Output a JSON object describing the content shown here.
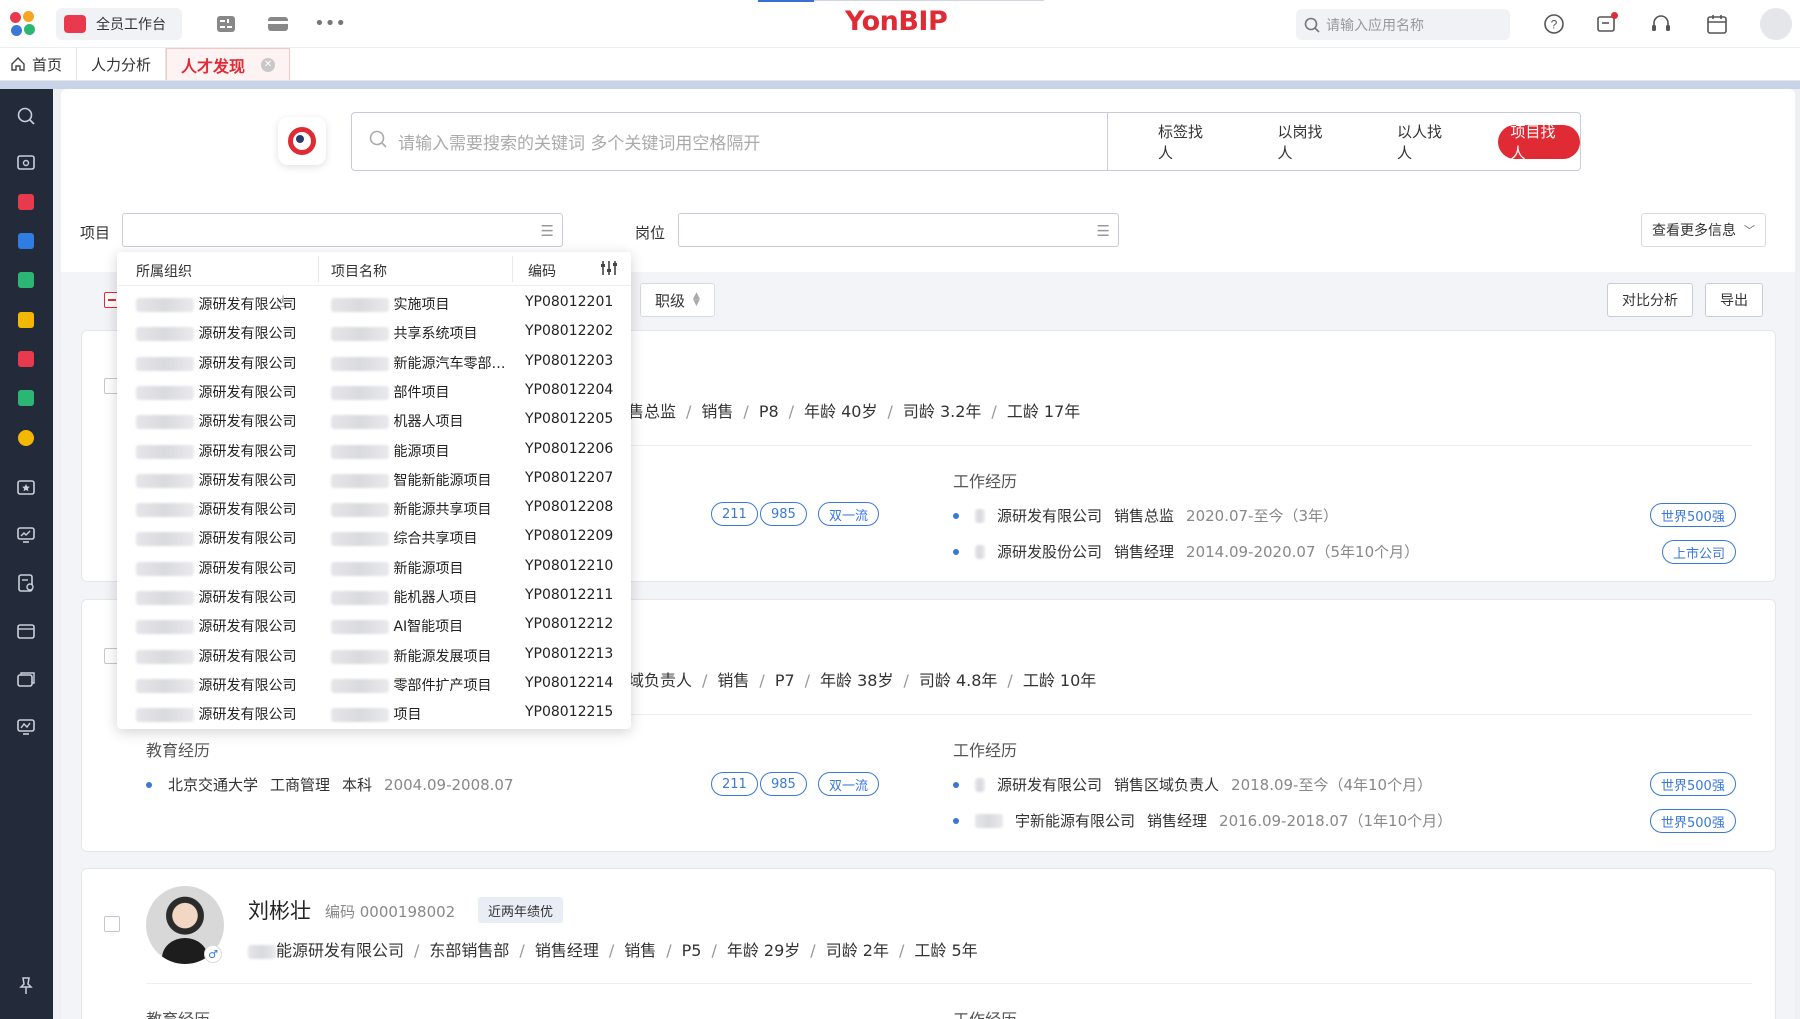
{
  "topbar": {
    "workbench_label": "全员工作台",
    "brand": "YonBIP",
    "app_search_placeholder": "请输入应用名称",
    "more_glyph": "•••"
  },
  "tabs": [
    {
      "label": "首页",
      "icon": "home-icon"
    },
    {
      "label": "人力分析"
    },
    {
      "label": "人才发现",
      "active": true
    }
  ],
  "search": {
    "placeholder": "请输入需要搜索的关键词 多个关键词用空格隔开",
    "modes": [
      "标签找人",
      "以岗找人",
      "以人找人",
      "项目找人"
    ],
    "active_mode": "项目找人"
  },
  "filters": {
    "project_label": "项目",
    "position_label": "岗位",
    "more_info": "查看更多信息"
  },
  "toolbar": {
    "sort_label": "职级",
    "compare": "对比分析",
    "export": "导出"
  },
  "dropdown": {
    "headers": {
      "org": "所属组织",
      "project": "项目名称",
      "code": "编码"
    },
    "rows": [
      {
        "org": "源研发有限公司",
        "project": "实施项目",
        "code": "YP08012201"
      },
      {
        "org": "源研发有限公司",
        "project": "共享系统项目",
        "code": "YP08012202"
      },
      {
        "org": "源研发有限公司",
        "project": "新能源汽车零部…",
        "code": "YP08012203"
      },
      {
        "org": "源研发有限公司",
        "project": "部件项目",
        "code": "YP08012204"
      },
      {
        "org": "源研发有限公司",
        "project": "机器人项目",
        "code": "YP08012205"
      },
      {
        "org": "源研发有限公司",
        "project": "能源项目",
        "code": "YP08012206"
      },
      {
        "org": "源研发有限公司",
        "project": "智能新能源项目",
        "code": "YP08012207"
      },
      {
        "org": "源研发有限公司",
        "project": "新能源共享项目",
        "code": "YP08012208"
      },
      {
        "org": "源研发有限公司",
        "project": "综合共享项目",
        "code": "YP08012209"
      },
      {
        "org": "源研发有限公司",
        "project": "新能源项目",
        "code": "YP08012210"
      },
      {
        "org": "源研发有限公司",
        "project": "能机器人项目",
        "code": "YP08012211"
      },
      {
        "org": "源研发有限公司",
        "project": "AI智能项目",
        "code": "YP08012212"
      },
      {
        "org": "源研发有限公司",
        "project": "新能源发展项目",
        "code": "YP08012213"
      },
      {
        "org": "源研发有限公司",
        "project": "零部件扩产项目",
        "code": "YP08012214"
      },
      {
        "org": "源研发有限公司",
        "project": "项目",
        "code": "YP08012215"
      }
    ]
  },
  "candidates": [
    {
      "meta": [
        "售总监",
        "销售",
        "P8",
        "年龄 40岁",
        "司龄 3.2年",
        "工龄 17年"
      ],
      "edu_tags": [
        "211",
        "985",
        "双一流"
      ],
      "work_title": "工作经历",
      "work": [
        {
          "company": "源研发有限公司",
          "role": "销售总监",
          "period": "2020.07-至今（3年）",
          "tag": "世界500强"
        },
        {
          "company": "源研发股份公司",
          "role": "销售经理",
          "period": "2014.09-2020.07（5年10个月）",
          "tag": "上市公司"
        }
      ]
    },
    {
      "meta": [
        "域负责人",
        "销售",
        "P7",
        "年龄 38岁",
        "司龄 4.8年",
        "工龄 10年"
      ],
      "edu_title": "教育经历",
      "education": {
        "school": "北京交通大学",
        "major": "工商管理",
        "degree": "本科",
        "period": "2004.09-2008.07"
      },
      "edu_tags": [
        "211",
        "985",
        "双一流"
      ],
      "work_title": "工作经历",
      "work": [
        {
          "company": "源研发有限公司",
          "role": "销售区域负责人",
          "period": "2018.09-至今（4年10个月）",
          "tag": "世界500强"
        },
        {
          "company": "宇新能源有限公司",
          "role": "销售经理",
          "period": "2016.09-2018.07（1年10个月）",
          "tag": "世界500强"
        }
      ]
    },
    {
      "name": "刘彬壮",
      "code": "编码 0000198002",
      "badge": "近两年绩优",
      "meta": [
        "能源研发有限公司",
        "东部销售部",
        "销售经理",
        "销售",
        "P5",
        "年龄 29岁",
        "司龄 2年",
        "工龄 5年"
      ],
      "edu_title": "教育经历",
      "work_title": "工作经历"
    }
  ],
  "colors": {
    "brand_red": "#e02b35",
    "link_blue": "#3a78d8",
    "sidebar_bg": "#232b3b"
  }
}
